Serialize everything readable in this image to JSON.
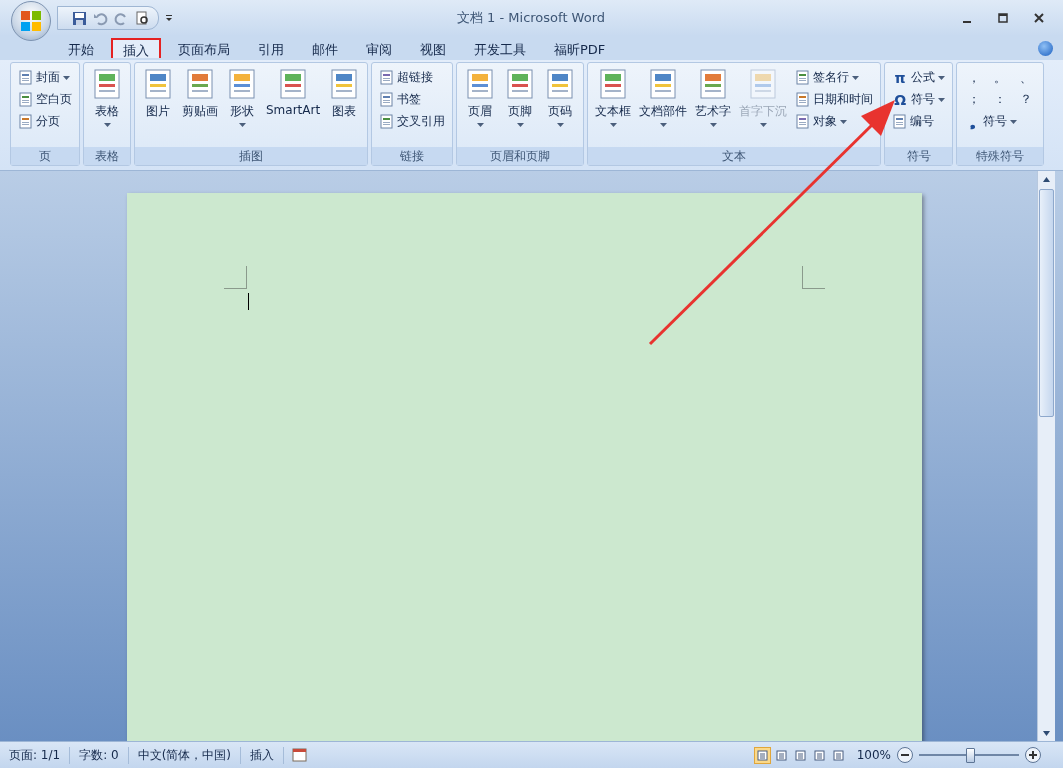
{
  "window": {
    "title": "文档 1 - Microsoft Word"
  },
  "tabs": [
    {
      "label": "开始",
      "selected": false,
      "highlighted": false
    },
    {
      "label": "插入",
      "selected": true,
      "highlighted": true
    },
    {
      "label": "页面布局",
      "selected": false,
      "highlighted": false
    },
    {
      "label": "引用",
      "selected": false,
      "highlighted": false
    },
    {
      "label": "邮件",
      "selected": false,
      "highlighted": false
    },
    {
      "label": "审阅",
      "selected": false,
      "highlighted": false
    },
    {
      "label": "视图",
      "selected": false,
      "highlighted": false
    },
    {
      "label": "开发工具",
      "selected": false,
      "highlighted": false
    },
    {
      "label": "福昕PDF",
      "selected": false,
      "highlighted": false
    }
  ],
  "ribbon": [
    {
      "label": "页",
      "items": [
        {
          "kind": "small",
          "label": "封面",
          "dropdown": true,
          "disabled": false
        },
        {
          "kind": "small",
          "label": "空白页",
          "dropdown": false,
          "disabled": false
        },
        {
          "kind": "small",
          "label": "分页",
          "dropdown": false,
          "disabled": false
        }
      ]
    },
    {
      "label": "表格",
      "items": [
        {
          "kind": "large",
          "label": "表格",
          "dropdown": true,
          "disabled": false
        }
      ]
    },
    {
      "label": "插图",
      "items": [
        {
          "kind": "large",
          "label": "图片",
          "dropdown": false,
          "disabled": false
        },
        {
          "kind": "large",
          "label": "剪贴画",
          "dropdown": false,
          "disabled": false
        },
        {
          "kind": "large",
          "label": "形状",
          "dropdown": true,
          "disabled": false
        },
        {
          "kind": "large",
          "label": "SmartArt",
          "dropdown": false,
          "disabled": false
        },
        {
          "kind": "large",
          "label": "图表",
          "dropdown": false,
          "disabled": false
        }
      ]
    },
    {
      "label": "链接",
      "items": [
        {
          "kind": "small",
          "label": "超链接",
          "dropdown": false,
          "disabled": false
        },
        {
          "kind": "small",
          "label": "书签",
          "dropdown": false,
          "disabled": false
        },
        {
          "kind": "small",
          "label": "交叉引用",
          "dropdown": false,
          "disabled": false
        }
      ]
    },
    {
      "label": "页眉和页脚",
      "items": [
        {
          "kind": "large",
          "label": "页眉",
          "dropdown": true,
          "disabled": false
        },
        {
          "kind": "large",
          "label": "页脚",
          "dropdown": true,
          "disabled": false
        },
        {
          "kind": "large",
          "label": "页码",
          "dropdown": true,
          "disabled": false
        }
      ]
    },
    {
      "label": "文本",
      "items": [
        {
          "kind": "large",
          "label": "文本框",
          "dropdown": true,
          "disabled": false
        },
        {
          "kind": "large",
          "label": "文档部件",
          "dropdown": true,
          "disabled": false
        },
        {
          "kind": "large",
          "label": "艺术字",
          "dropdown": true,
          "disabled": false
        },
        {
          "kind": "large",
          "label": "首字下沉",
          "dropdown": true,
          "disabled": true
        },
        {
          "kind": "small",
          "label": "签名行",
          "dropdown": true,
          "disabled": false
        },
        {
          "kind": "small",
          "label": "日期和时间",
          "dropdown": false,
          "disabled": false
        },
        {
          "kind": "small",
          "label": "对象",
          "dropdown": true,
          "disabled": false
        }
      ]
    },
    {
      "label": "符号",
      "items": [
        {
          "kind": "small",
          "label": "公式",
          "dropdown": true,
          "disabled": false,
          "glyph": "π"
        },
        {
          "kind": "small",
          "label": "符号",
          "dropdown": true,
          "disabled": false,
          "glyph": "Ω"
        },
        {
          "kind": "small",
          "label": "编号",
          "dropdown": false,
          "disabled": false
        }
      ]
    },
    {
      "label": "特殊符号",
      "items": [
        {
          "kind": "symbols",
          "symbols": [
            "，",
            "。",
            "、",
            "；",
            "：",
            "？"
          ]
        },
        {
          "kind": "small",
          "label": "符号",
          "dropdown": true,
          "disabled": false,
          "glyph": "❟"
        }
      ]
    }
  ],
  "status_bar": {
    "items": [
      "页面: 1/1",
      "字数: 0",
      "中文(简体，中国)",
      "插入"
    ],
    "zoom": "100%",
    "zoom_slider": {
      "level": 0.5
    }
  }
}
